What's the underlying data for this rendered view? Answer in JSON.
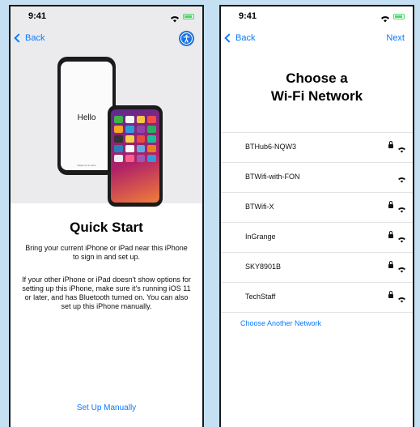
{
  "left_screen": {
    "status_time": "9:41",
    "back_label": "Back",
    "hero_text": "Hello",
    "hero_small_text": "Swipe up to open",
    "title": "Quick Start",
    "paragraph1": "Bring your current iPhone or iPad near this iPhone to sign in and set up.",
    "paragraph2": "If your other iPhone or iPad doesn't show options for setting up this iPhone, make sure it's running iOS 11 or later, and has Bluetooth turned on. You can also set up this iPhone manually.",
    "manual_link": "Set Up Manually"
  },
  "right_screen": {
    "status_time": "9:41",
    "back_label": "Back",
    "next_label": "Next",
    "title_line1": "Choose a",
    "title_line2": "Wi-Fi Network",
    "networks": [
      {
        "name": "BTHub6-NQW3",
        "locked": true
      },
      {
        "name": "BTWifi-with-FON",
        "locked": false
      },
      {
        "name": "BTWifi-X",
        "locked": true
      },
      {
        "name": "InGrange",
        "locked": true
      },
      {
        "name": "SKY8901B",
        "locked": true
      },
      {
        "name": "TechStaff",
        "locked": true
      }
    ],
    "choose_another": "Choose Another Network"
  },
  "colors": {
    "background": "#c4e0f2",
    "accent": "#0a7aff",
    "battery": "#4cd964"
  }
}
